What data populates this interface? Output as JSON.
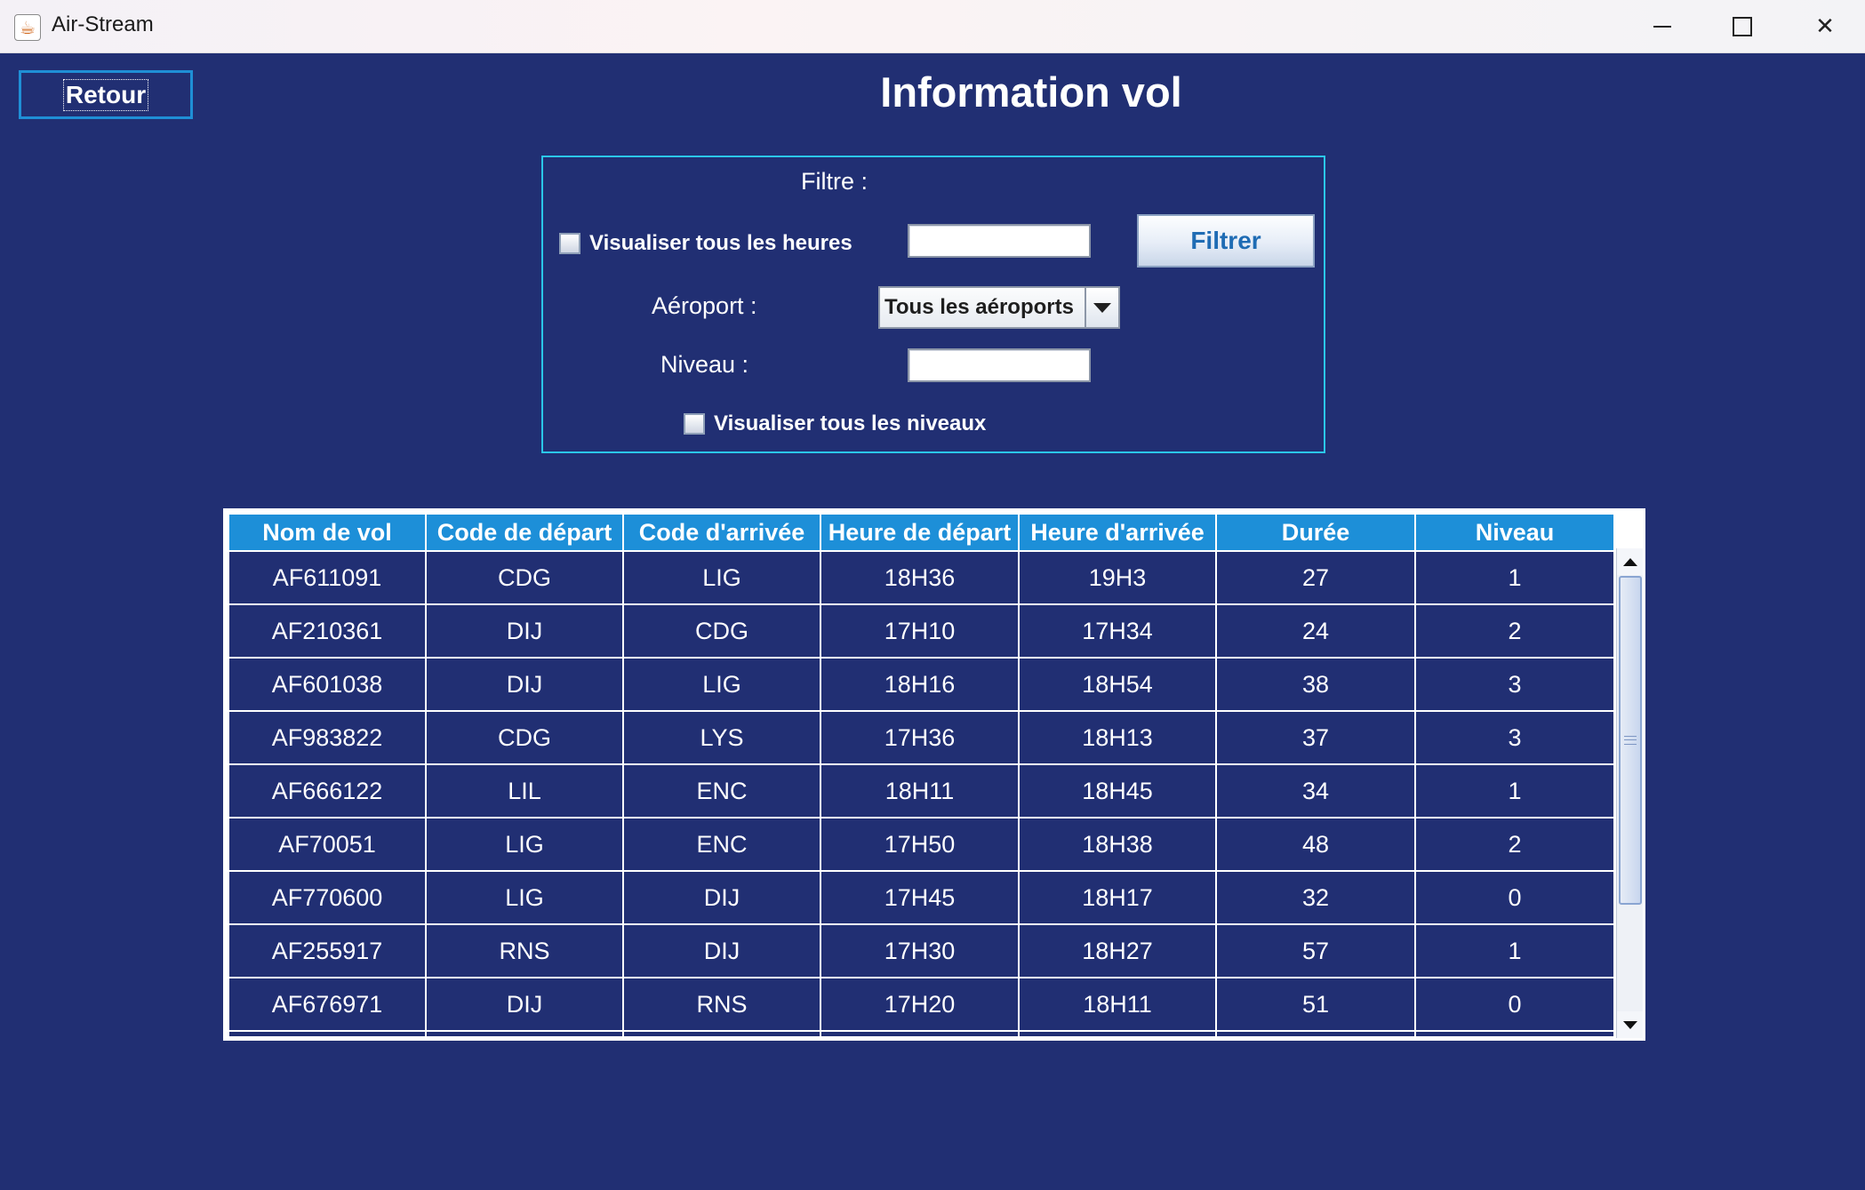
{
  "window": {
    "title": "Air-Stream",
    "icon": "java-cup-icon",
    "controls": [
      "minimize-icon",
      "maximize-icon",
      "close-icon"
    ]
  },
  "header": {
    "back_label": "Retour",
    "title": "Information vol"
  },
  "filter": {
    "title": "Filtre :",
    "all_hours_label": "Visualiser tous les heures",
    "all_hours_checked": false,
    "hours_value": "",
    "filter_button": "Filtrer",
    "airport_label": "Aéroport :",
    "airport_selected": "Tous les aéroports",
    "level_label": "Niveau :",
    "level_value": "",
    "all_levels_label": "Visualiser tous les niveaux",
    "all_levels_checked": false
  },
  "table": {
    "columns": [
      "Nom de vol",
      "Code de départ",
      "Code d'arrivée",
      "Heure de départ",
      "Heure d'arrivée",
      "Durée",
      "Niveau"
    ],
    "rows": [
      [
        "AF611091",
        "CDG",
        "LIG",
        "18H36",
        "19H3",
        "27",
        "1"
      ],
      [
        "AF210361",
        "DIJ",
        "CDG",
        "17H10",
        "17H34",
        "24",
        "2"
      ],
      [
        "AF601038",
        "DIJ",
        "LIG",
        "18H16",
        "18H54",
        "38",
        "3"
      ],
      [
        "AF983822",
        "CDG",
        "LYS",
        "17H36",
        "18H13",
        "37",
        "3"
      ],
      [
        "AF666122",
        "LIL",
        "ENC",
        "18H11",
        "18H45",
        "34",
        "1"
      ],
      [
        "AF70051",
        "LIG",
        "ENC",
        "17H50",
        "18H38",
        "48",
        "2"
      ],
      [
        "AF770600",
        "LIG",
        "DIJ",
        "17H45",
        "18H17",
        "32",
        "0"
      ],
      [
        "AF255917",
        "RNS",
        "DIJ",
        "17H30",
        "18H27",
        "57",
        "1"
      ],
      [
        "AF676971",
        "DIJ",
        "RNS",
        "17H20",
        "18H11",
        "51",
        "0"
      ],
      [
        "",
        "",
        "",
        "",
        "",
        "",
        ""
      ]
    ]
  },
  "colors": {
    "background": "#212f73",
    "header_blue": "#1d8fd8",
    "panel_border": "#2bc7e8",
    "button_text": "#1f6cb4"
  }
}
